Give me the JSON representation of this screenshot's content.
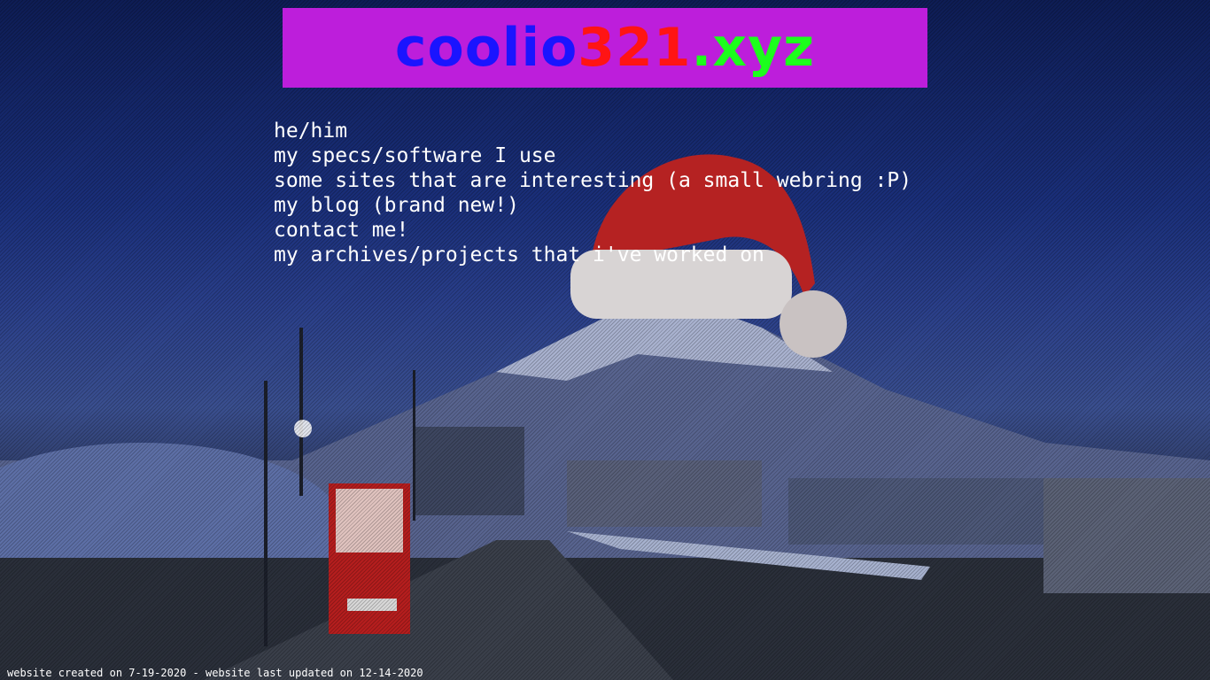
{
  "site": {
    "title_part1": "coolio",
    "title_part2": "321",
    "title_part3": ".xyz",
    "colors": {
      "banner_bg": "#bd1edb",
      "title_part1": "#1a14ff",
      "title_part2": "#ff1414",
      "title_part3": "#1cff1c"
    }
  },
  "nav": {
    "pronouns": "he/him",
    "items": [
      "my specs/software I use",
      "some sites that are interesting (a small webring :P)",
      "my blog (brand new!)",
      "contact me!",
      "my archives/projects that i've worked on"
    ]
  },
  "footer": {
    "text": "website created on 7-19-2020 - website last updated on 12-14-2020"
  },
  "decorations": {
    "background": "snowy-mountain-night-scene",
    "overlay": "santa-hat-image"
  }
}
